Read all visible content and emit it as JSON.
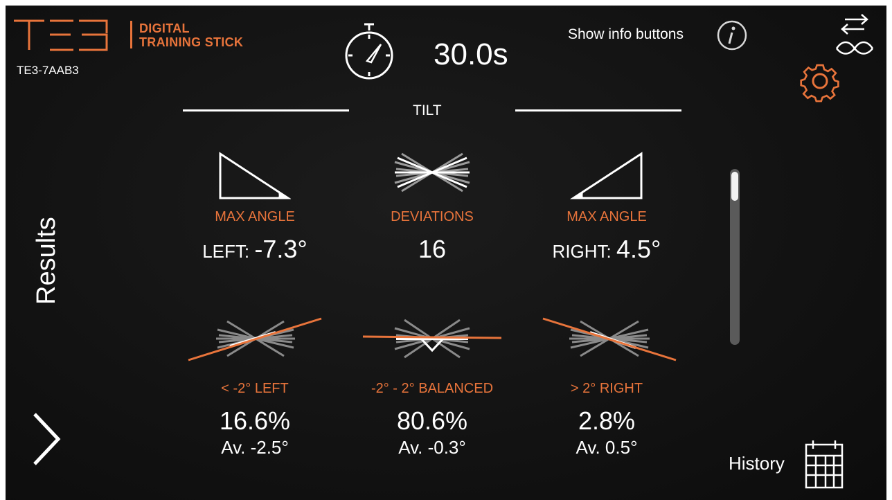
{
  "header": {
    "brand_sub_line1": "DIGITAL",
    "brand_sub_line2": "TRAINING STICK",
    "device_id": "TE3-7AAB3",
    "timer_value": "30.0s",
    "info_toggle_label": "Show info buttons"
  },
  "section": {
    "title": "TILT"
  },
  "side": {
    "results_label": "Results"
  },
  "stats": [
    {
      "label": "MAX ANGLE",
      "prefix": "LEFT: ",
      "value": "-7.3°",
      "icon": "max-angle-left-icon"
    },
    {
      "label": "DEVIATIONS",
      "prefix": "",
      "value": "16",
      "icon": "deviations-icon"
    },
    {
      "label": "MAX ANGLE",
      "prefix": "RIGHT: ",
      "value": "4.5°",
      "icon": "max-angle-right-icon"
    }
  ],
  "distribution": [
    {
      "label": "< -2° LEFT",
      "percent": "16.6%",
      "average": "Av. -2.5°",
      "icon": "tilt-left-icon"
    },
    {
      "label": "-2° - 2° BALANCED",
      "percent": "80.6%",
      "average": "Av. -0.3°",
      "icon": "tilt-balanced-icon"
    },
    {
      "label": "> 2° RIGHT",
      "percent": "2.8%",
      "average": "Av. 0.5°",
      "icon": "tilt-right-icon"
    }
  ],
  "footer": {
    "history_label": "History"
  },
  "colors": {
    "accent": "#e8743b",
    "background": "#121212",
    "text": "#ffffff",
    "scroll_track": "#5a5a5a"
  },
  "icons": [
    "te3-logo",
    "stopwatch-icon",
    "info-icon",
    "swap-device-icon",
    "gear-icon",
    "chevron-right-icon",
    "calendar-icon"
  ]
}
